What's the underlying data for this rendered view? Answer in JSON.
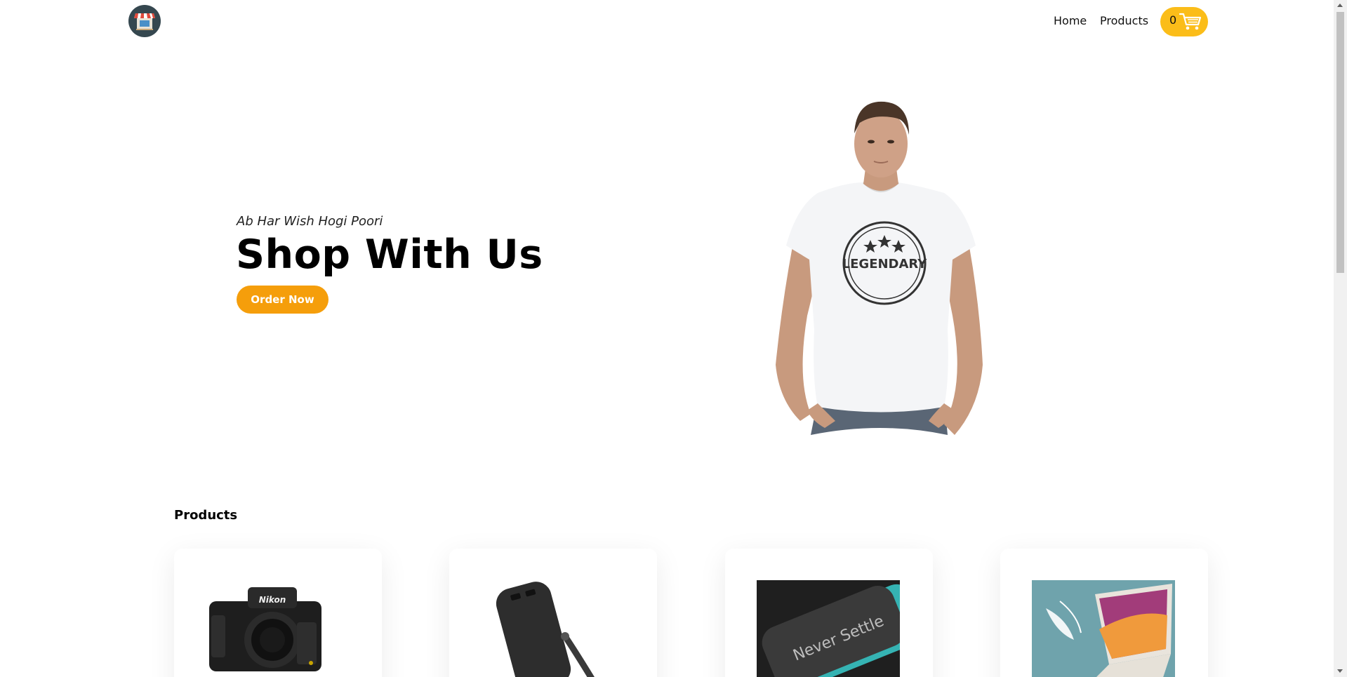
{
  "header": {
    "logo_icon": "storefront-icon",
    "nav": [
      {
        "label": "Home"
      },
      {
        "label": "Products"
      }
    ],
    "cart": {
      "count": "0",
      "icon": "shopping-cart-icon"
    }
  },
  "hero": {
    "tagline": "Ab Har Wish Hogi Poori",
    "title": "Shop With Us",
    "button_label": "Order Now",
    "image_icon": "model-tshirt-image",
    "tshirt_print": "LEGENDARY"
  },
  "products": {
    "section_title": "Products",
    "items": [
      {
        "image": "camera-image",
        "brand_text": "Nikon"
      },
      {
        "image": "power-bank-image"
      },
      {
        "image": "power-bank-never-settle-image",
        "print_text": "Never Settle"
      },
      {
        "image": "laptop-image"
      }
    ]
  },
  "colors": {
    "accent": "#fbbd19",
    "button": "#f59e0b",
    "logo_bg": "#35474f"
  }
}
